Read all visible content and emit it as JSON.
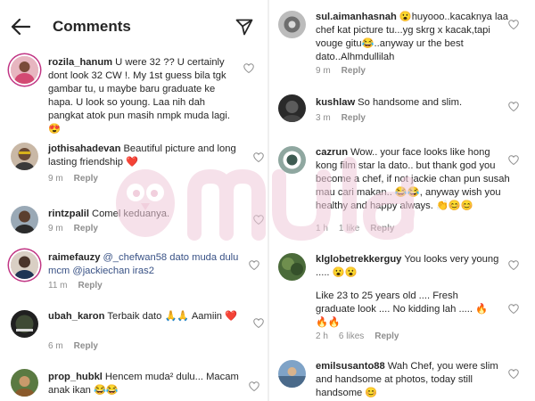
{
  "header": {
    "title": "Comments"
  },
  "left_comments": [
    {
      "username": "rozila_hanum",
      "text": "U were 32 ?? U certainly dont look 32 CW !. My 1st guess bila tgk gambar tu, u maybe baru graduate ke hapa. U look so young. Laa nih dah pangkat atok pun masih nmpk muda lagi. 😍",
      "time": "",
      "likes": "",
      "reply": ""
    },
    {
      "username": "jothisahadevan",
      "text": "Beautiful picture and long lasting friendship ❤️",
      "time": "9 m",
      "likes": "",
      "reply": "Reply"
    },
    {
      "username": "rintzpalil",
      "text": "Comel keduanya.",
      "time": "9 m",
      "likes": "",
      "reply": "Reply"
    },
    {
      "username": "raimefauzy",
      "text": "@_chefwan58 dato muda dulu mcm @jackiechan iras2",
      "time": "11 m",
      "likes": "",
      "reply": "Reply"
    },
    {
      "username": "ubah_karon",
      "text": "Terbaik dato 🙏🙏 Aamiin ❤️",
      "time": "6 m",
      "likes": "",
      "reply": "Reply"
    },
    {
      "username": "prop_hubkl",
      "text": "Hencem muda² dulu... Macam anak ikan 😂😂",
      "time": "",
      "likes": "",
      "reply": ""
    }
  ],
  "right_comments": [
    {
      "username": "sul.aimanhasnah",
      "text": "😮huyooo..kacaknya laa chef kat picture tu...yg skrg x kacak,tapi vouge gitu😂..anyway ur the best dato..Alhmdullilah",
      "time": "9 m",
      "likes": "",
      "reply": "Reply"
    },
    {
      "username": "kushlaw",
      "text": "So handsome and slim.",
      "time": "3 m",
      "likes": "",
      "reply": "Reply"
    },
    {
      "username": "cazrun",
      "text": "Wow.. your face looks like hong kong film star la dato.. but thank god you become a chef, if not jackie chan pun susah mau cari makan.. 😂😂, anyway wish you healthy and happy always. 👏😊😊",
      "time": "1 h",
      "likes": "1 like",
      "reply": "Reply"
    },
    {
      "username": "klglobetrekkerguy",
      "text": "You looks very young ..... 😮😮",
      "time": "",
      "likes": "",
      "reply": ""
    },
    {
      "username": "",
      "text": "Like 23 to 25 years old .... Fresh graduate look .... No kidding lah ..... 🔥 🔥🔥",
      "time": "2 h",
      "likes": "6 likes",
      "reply": "Reply"
    },
    {
      "username": "emilsusanto88",
      "text": "Wah Chef, you were slim and handsome at photos, today still handsome 😊",
      "time": "",
      "likes": "",
      "reply": ""
    }
  ],
  "watermark": {
    "text": "mulai"
  },
  "colors": {
    "text": "#262626",
    "meta": "#8e8e8e",
    "mention": "#385185",
    "divider": "#efefef",
    "watermark": "#f0c9d9"
  }
}
